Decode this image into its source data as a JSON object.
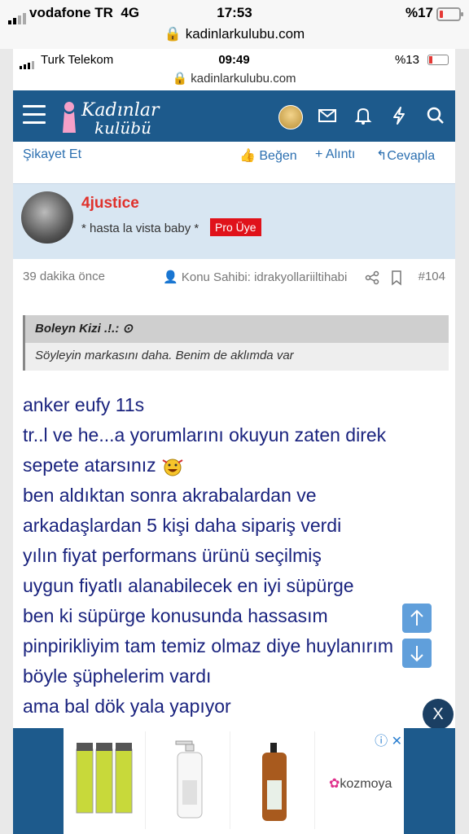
{
  "outer_status": {
    "carrier": "vodafone TR",
    "network": "4G",
    "time": "17:53",
    "battery": "%17",
    "url": "kadinlarkulubu.com"
  },
  "inner_status": {
    "carrier": "Turk Telekom",
    "time": "09:49",
    "battery": "%13",
    "url": "kadinlarkulubu.com"
  },
  "nav": {
    "logo_line1": "Kadınlar",
    "logo_line2": "kulübü"
  },
  "actions": {
    "report": "Şikayet Et",
    "like": "Beğen",
    "quote": "+ Alıntı",
    "reply": "Cevapla"
  },
  "post": {
    "username": "4justice",
    "user_title": "* hasta la vista baby *",
    "badge": "Pro Üye",
    "time": "39 dakika önce",
    "owner": "Konu Sahibi: idrakyollariiltihabi",
    "number": "#104"
  },
  "quote": {
    "author": "Boleyn Kizi .!.:",
    "text": "Söyleyin markasını daha. Benim de aklımda var"
  },
  "content": {
    "lines": [
      "anker eufy 11s",
      "tr..l ve he...a yorumlarını okuyun zaten direk",
      "sepete atarsınız",
      "ben aldıktan sonra akrabalardan ve",
      "arkadaşlardan 5 kişi daha sipariş verdi",
      "yılın fiyat performans ürünü seçilmiş",
      "uygun fiyatlı alanabilecek en iyi süpürge",
      "ben ki süpürge konusunda hassasım",
      "pinpirikliyim tam temiz olmaz diye huylanırım",
      "böyle şüphelerim vardı",
      "ama bal dök yala yapıyor"
    ]
  },
  "ad": {
    "close": "X",
    "brand": "kozmoya"
  }
}
